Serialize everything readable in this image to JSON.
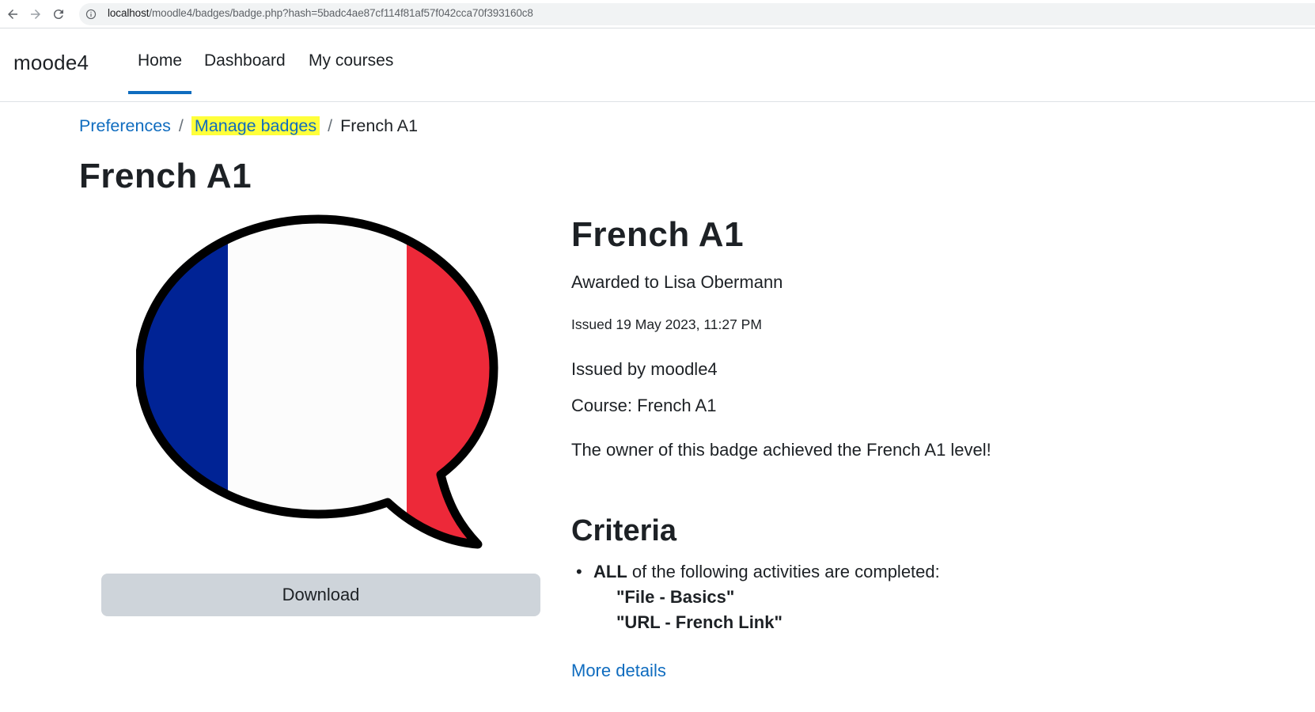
{
  "browser": {
    "url_host": "localhost",
    "url_path": "/moodle4/badges/badge.php?hash=5badc4ae87cf114f81af57f042cca70f393160c8"
  },
  "navbar": {
    "brand": "moode4",
    "items": [
      {
        "label": "Home",
        "active": true
      },
      {
        "label": "Dashboard",
        "active": false
      },
      {
        "label": "My courses",
        "active": false
      }
    ]
  },
  "breadcrumb": {
    "items": [
      "Preferences",
      "Manage badges",
      "French A1"
    ],
    "separator": "/"
  },
  "page": {
    "title": "French A1"
  },
  "badge": {
    "download_label": "Download",
    "name": "French A1",
    "awarded_to": "Awarded to Lisa Obermann",
    "issued_date": "Issued 19 May 2023, 11:27 PM",
    "issued_by": "Issued by moodle4",
    "course": "Course: French A1",
    "description": "The owner of this badge achieved the French A1 level!",
    "image_icon": "french-flag-speech-bubble-icon"
  },
  "criteria": {
    "heading": "Criteria",
    "condition_strong": "ALL",
    "condition_text": " of the following activities are completed:",
    "activities": [
      "\"File - Basics\"",
      "\"URL - French Link\""
    ],
    "more_details": "More details"
  },
  "colors": {
    "link": "#0f6cbf",
    "highlight": "#ffff3a",
    "flag_blue": "#002395",
    "flag_red": "#ed2939",
    "button_bg": "#ced4da"
  }
}
